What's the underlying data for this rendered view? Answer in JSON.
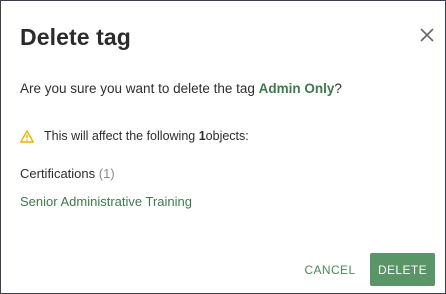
{
  "dialog": {
    "title": "Delete tag",
    "question_prefix": "Are you sure you want to delete the tag ",
    "tag_name": "Admin Only",
    "question_suffix": "?",
    "warning_prefix": "This will affect the following ",
    "warning_count": "1",
    "warning_suffix": " objects:",
    "category_label": "Certifications",
    "category_count": "(1)",
    "affected_item": "Senior Administrative Training",
    "cancel_label": "CANCEL",
    "delete_label": "DELETE"
  },
  "colors": {
    "accent_green": "#3d7a4c",
    "delete_button": "#5a9567",
    "warning_yellow": "#f0b400"
  },
  "icons": {
    "close": "close-icon",
    "warning": "warning-icon"
  }
}
